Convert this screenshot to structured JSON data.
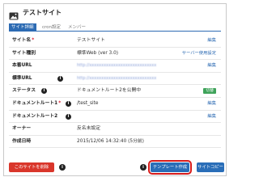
{
  "header": {
    "title": "テストサイト",
    "icon": "image-icon"
  },
  "tabs": [
    {
      "label": "サイト詳細",
      "active": true
    },
    {
      "label": "cron設定",
      "active": false
    },
    {
      "label": "メンバー",
      "active": false
    }
  ],
  "rows": {
    "site_name": {
      "label": "サイト名",
      "required": "*",
      "value": "テストサイト",
      "edit": "編集"
    },
    "site_type": {
      "label": "サイト種別",
      "value": "標準Web (ver 3.0)",
      "edit": "サーバー使用設定"
    },
    "main_url": {
      "label": "本番URL",
      "value": "http://xxxxxxxxxxxxxxxxxxxxxxxxxxxx",
      "edit": "編集"
    },
    "std_url": {
      "label": "標準URL",
      "value": "http://xxxxxxxxxxxxxxxxxxxxxxxxxxxx"
    },
    "status": {
      "label": "ステータス",
      "value": "ドキュメントルート2を公開中",
      "badge": "切替"
    },
    "docroot1": {
      "label": "ドキュメントルート1",
      "required": "*",
      "value": "/test_site",
      "edit": "編集"
    },
    "docroot2": {
      "label": "ドキュメントルート2",
      "edit": "編集"
    },
    "owner": {
      "label": "オーナー",
      "value": "反名未設定"
    },
    "created": {
      "label": "作成日時",
      "value": "2015/12/06 14:32:40 (5分前)"
    }
  },
  "actions": {
    "delete": "このサイトを削除",
    "template": "テンプレート作成",
    "copy": "サイトコピー"
  },
  "colors": {
    "primary": "#2d6bb3",
    "danger": "#d9362b",
    "success": "#3fa35a",
    "highlight": "#d61b1b"
  }
}
